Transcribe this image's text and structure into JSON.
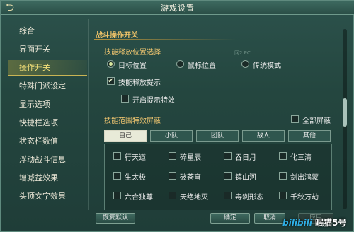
{
  "window": {
    "title": "游戏设置"
  },
  "sidebar": {
    "items": [
      {
        "label": "综合"
      },
      {
        "label": "界面开关"
      },
      {
        "label": "操作开关",
        "active": true
      },
      {
        "label": "特殊门派设定"
      },
      {
        "label": "显示选项"
      },
      {
        "label": "快捷栏选项"
      },
      {
        "label": "状态栏数值"
      },
      {
        "label": "浮动战斗信息"
      },
      {
        "label": "增减益效果"
      },
      {
        "label": "头顶文字效果"
      }
    ]
  },
  "main": {
    "section_title": "战斗操作开关",
    "skill_position": {
      "label": "技能释放位置选择",
      "options": [
        {
          "label": "目标位置",
          "selected": true
        },
        {
          "label": "鼠标位置",
          "selected": false
        },
        {
          "label": "传统模式",
          "selected": false
        }
      ]
    },
    "skill_hint": {
      "label": "技能释放提示",
      "checked": true
    },
    "hint_effect": {
      "label": "开启提示特效",
      "checked": false
    },
    "faint_text": "网2.PC",
    "effects_block": {
      "label": "技能范围特效屏蔽",
      "block_all": {
        "label": "全部屏蔽",
        "checked": false
      },
      "tabs": [
        {
          "label": "自己",
          "active": true
        },
        {
          "label": "小队"
        },
        {
          "label": "团队"
        },
        {
          "label": "敌人"
        },
        {
          "label": "其他"
        }
      ],
      "skills": [
        [
          "行天道",
          "碎星辰",
          "吞日月",
          "化三清"
        ],
        [
          "生太极",
          "破苍穹",
          "镇山河",
          "剑出鸿蒙"
        ],
        [
          "六合独尊",
          "天绝地灭",
          "毒刹形态",
          "千秋万劫"
        ]
      ]
    }
  },
  "footer": {
    "restore_default": "恢复默认",
    "confirm": "确定",
    "cancel": "取消",
    "apply": "应用"
  },
  "watermark": {
    "site": "bilibili",
    "user": "眠猫5号"
  },
  "colors": {
    "accent_gold": "#f4c66a",
    "active_item": "#f7e27a",
    "panel_bg": "#24463f"
  },
  "icons": {
    "back": "back-arrow-icon",
    "check": "checkmark-icon"
  }
}
